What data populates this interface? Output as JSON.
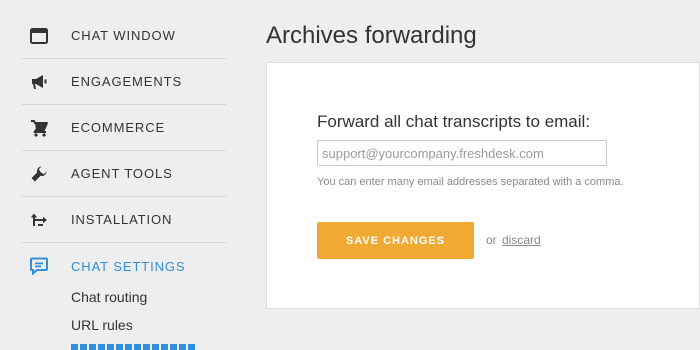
{
  "sidebar": {
    "items": [
      {
        "label": "CHAT WINDOW",
        "icon": "chat-window-icon"
      },
      {
        "label": "ENGAGEMENTS",
        "icon": "megaphone-icon"
      },
      {
        "label": "ECOMMERCE",
        "icon": "shopping-cart-icon"
      },
      {
        "label": "AGENT TOOLS",
        "icon": "wrench-icon"
      },
      {
        "label": "INSTALLATION",
        "icon": "transfer-arrows-icon"
      },
      {
        "label": "CHAT SETTINGS",
        "icon": "chat-bubble-icon",
        "active": true
      }
    ],
    "sub_items": [
      {
        "label": "Chat routing"
      },
      {
        "label": "URL rules"
      }
    ]
  },
  "main": {
    "title": "Archives forwarding",
    "form": {
      "field_label": "Forward all chat transcripts to email:",
      "email_placeholder": "support@yourcompany.freshdesk.com",
      "email_value": "",
      "hint": "You can enter many email addresses separated with a comma.",
      "save_label": "SAVE CHANGES",
      "or_text": "or",
      "discard_label": "discard"
    }
  },
  "colors": {
    "accent": "#2f8fdc",
    "save_button": "#f0aa33",
    "background": "#eeeeee",
    "card": "#ffffff"
  }
}
